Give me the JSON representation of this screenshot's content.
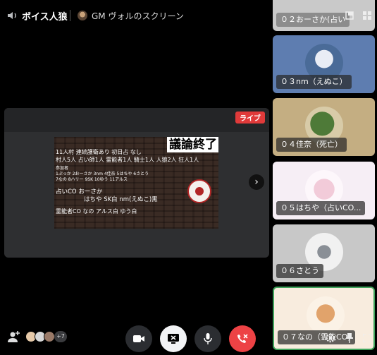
{
  "header": {
    "channel_name": "ボイス人狼",
    "stream_title": "GM ヴォルのスクリーン"
  },
  "stream": {
    "live_label": "ライブ",
    "screen": {
      "title": "議論終了",
      "lines": [
        "11人村 連続護衛あり 初日占 なし",
        "村人5人 占い師1人 霊能者1人 騎士1人 人狼2人 狂人1人",
        "参加者",
        "1ぷっか 2おーさか 3nm 4佳奈 5はちや 6さとう",
        "7なの 8ハリー 9SK 10ゆう 11アルス",
        "占いCO おーさか",
        "はちや SK白 nm(えぬこ)黒",
        "霊能者CO なの アルス白 ゆう白"
      ]
    }
  },
  "participants": [
    {
      "label": "０２おーさか(占い"
    },
    {
      "label": "０３nm（えぬこ）"
    },
    {
      "label": "０４佳奈（死亡）"
    },
    {
      "label": "０５はちや（占いCO..."
    },
    {
      "label": "０６さとう"
    },
    {
      "label": "０７なの（霊能CO)"
    }
  ],
  "footer": {
    "extra_count": "+7"
  },
  "icons": {
    "volume": "speaker-icon",
    "add_member": "add-person-icon",
    "camera": "camera-icon",
    "screen_share": "stop-screen-share-icon",
    "mic": "microphone-icon",
    "leave": "phone-hangup-icon",
    "settings": "gear-icon",
    "pin": "pin-icon",
    "fullscreen": "fullscreen-icon",
    "grid": "grid-icon",
    "popout": "popout-icon",
    "next": "chevron-right-icon"
  },
  "colors": {
    "live": "#e03a3a",
    "hangup": "#ed4245",
    "speaking_border": "#3fa35b"
  }
}
